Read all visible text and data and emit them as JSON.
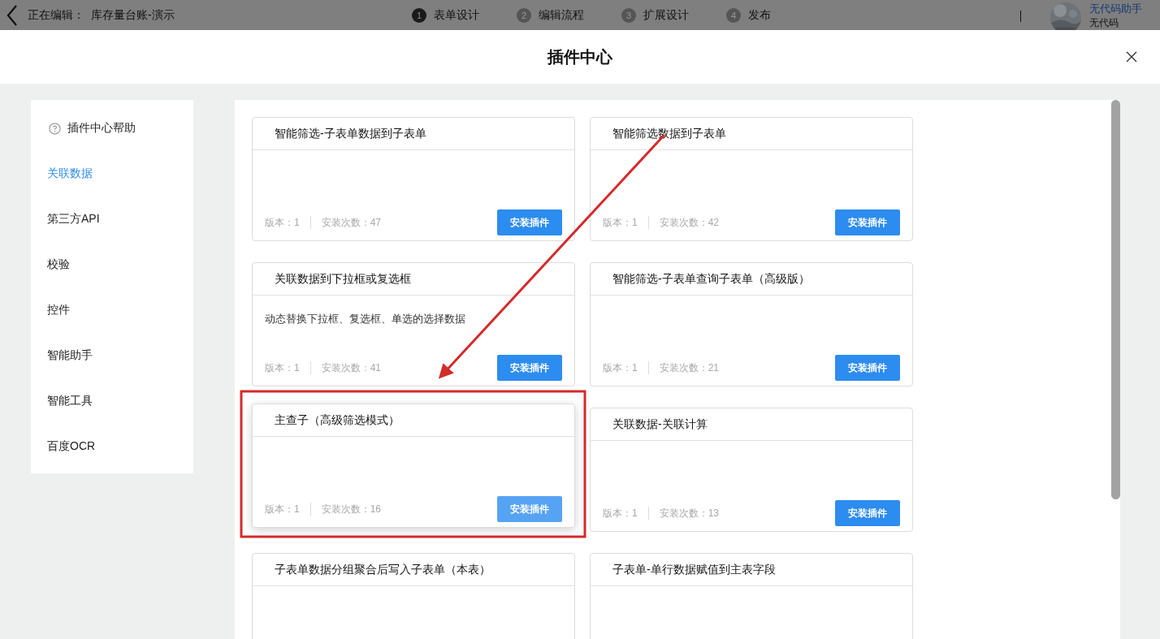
{
  "top_bar": {
    "editing_label": "正在编辑：",
    "form_name": "库存量台账-演示",
    "steps": [
      {
        "number": "1",
        "label": "表单设计",
        "selected": true
      },
      {
        "number": "2",
        "label": "编辑流程",
        "selected": false
      },
      {
        "number": "3",
        "label": "扩展设计",
        "selected": false
      },
      {
        "number": "4",
        "label": "发布",
        "selected": false
      }
    ],
    "user": {
      "name": "无代码助手",
      "org": "无代码"
    }
  },
  "dialog": {
    "title": "插件中心"
  },
  "sidebar": {
    "items": [
      {
        "label": "插件中心帮助",
        "kind": "help",
        "selected": false
      },
      {
        "label": "关联数据",
        "kind": "category",
        "selected": true
      },
      {
        "label": "第三方API",
        "kind": "category",
        "selected": false
      },
      {
        "label": "校验",
        "kind": "category",
        "selected": false
      },
      {
        "label": "控件",
        "kind": "category",
        "selected": false
      },
      {
        "label": "智能助手",
        "kind": "category",
        "selected": false
      },
      {
        "label": "智能工具",
        "kind": "category",
        "selected": false
      },
      {
        "label": "百度OCR",
        "kind": "category",
        "selected": false
      }
    ]
  },
  "plugins": [
    {
      "title": "智能筛选-子表单数据到子表单",
      "version": "版本：1",
      "installs": "安装次数：47",
      "button": "安装插件",
      "hovered": false
    },
    {
      "title": "智能筛选数据到子表单",
      "version": "版本：1",
      "installs": "安装次数：42",
      "button": "安装插件",
      "hovered": false
    },
    {
      "title": "关联数据到下拉框或复选框",
      "description": "动态替换下拉框、复选框、单选的选择数据",
      "version": "版本：1",
      "installs": "安装次数：41",
      "button": "安装插件",
      "hovered": false
    },
    {
      "title": "智能筛选-子表单查询子表单（高级版）",
      "version": "版本：1",
      "installs": "安装次数：21",
      "button": "安装插件",
      "hovered": false
    },
    {
      "title": "主查子（高级筛选模式）",
      "version": "版本：1",
      "installs": "安装次数：16",
      "button": "安装插件",
      "hovered": true
    },
    {
      "title": "关联数据-关联计算",
      "version": "版本：1",
      "installs": "安装次数：13",
      "button": "安装插件",
      "hovered": false
    },
    {
      "title": "子表单数据分组聚合后写入子表单（本表）",
      "hovered": false
    },
    {
      "title": "子表单-单行数据赋值到主表字段",
      "hovered": false
    }
  ]
}
